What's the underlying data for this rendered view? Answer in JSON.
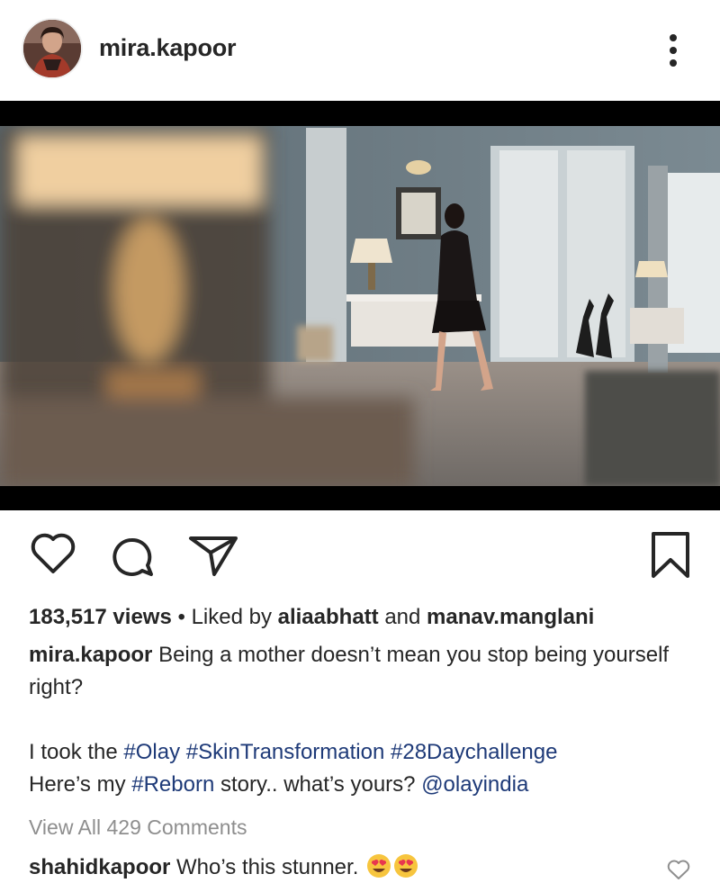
{
  "post": {
    "username": "mira.kapoor",
    "views": "183,517 views",
    "liked_by_prefix": "Liked by",
    "liked_by_user_1": "aliaabhatt",
    "liked_by_and": "and",
    "liked_by_user_2": "manav.manglani",
    "caption": {
      "username": "mira.kapoor",
      "line1": "Being a mother doesn’t mean you stop being yourself right?",
      "line2_prefix": "I took the",
      "tag1": "#Olay",
      "tag2": "#SkinTransformation",
      "tag3": "#28Daychallenge",
      "line3_prefix": "Here’s my",
      "tag4": "#Reborn",
      "line3_mid": "story.. what’s yours?",
      "mention": "@olayindia"
    },
    "view_all_comments": "View All 429 Comments",
    "comment": {
      "username": "shahidkapoor",
      "text": "Who’s this stunner."
    }
  },
  "icons": {
    "like": "heart-icon",
    "comment": "comment-bubble-icon",
    "share": "paper-plane-icon",
    "save": "bookmark-icon",
    "more": "vertical-ellipsis-icon",
    "comment_like": "small-heart-icon",
    "emoji": "heart-eyes-emoji"
  },
  "colors": {
    "text": "#262626",
    "link": "#1e3a78",
    "muted": "#8e8e8e"
  }
}
